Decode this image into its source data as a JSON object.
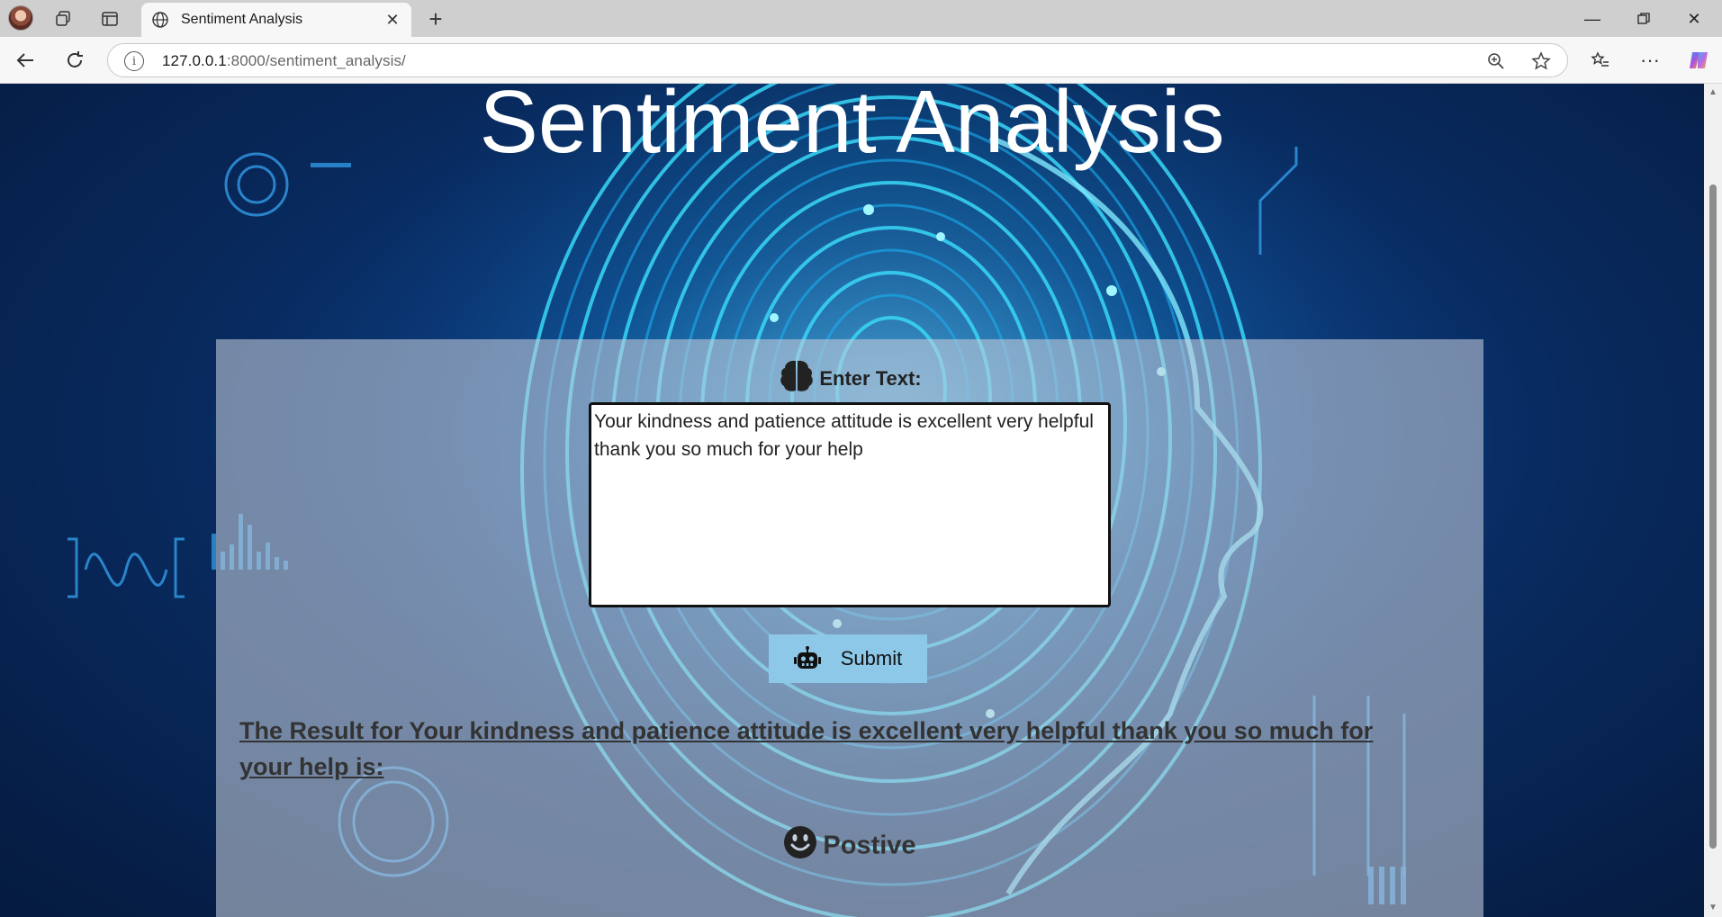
{
  "browser": {
    "tab_title": "Sentiment Analysis",
    "url_host": "127.0.0.1",
    "url_path": ":8000/sentiment_analysis/"
  },
  "page": {
    "title": "Sentiment Analysis",
    "enter_label": "Enter Text:",
    "input_value": "Your kindness and patience attitude is excellent very helpful thank you so much for your help",
    "submit_label": "Submit",
    "result_text": "The Result for Your kindness and patience attitude is excellent very helpful thank you so much for your help is:",
    "sentiment": "Postive"
  },
  "icons": {
    "tab": "globe-icon",
    "enter": "brain-icon",
    "submit": "robot-icon",
    "result": "smile-icon"
  },
  "colors": {
    "submit_bg": "#8ec8e8",
    "panel_bg": "rgba(196,205,219,0.58)",
    "title": "#ffffff"
  }
}
